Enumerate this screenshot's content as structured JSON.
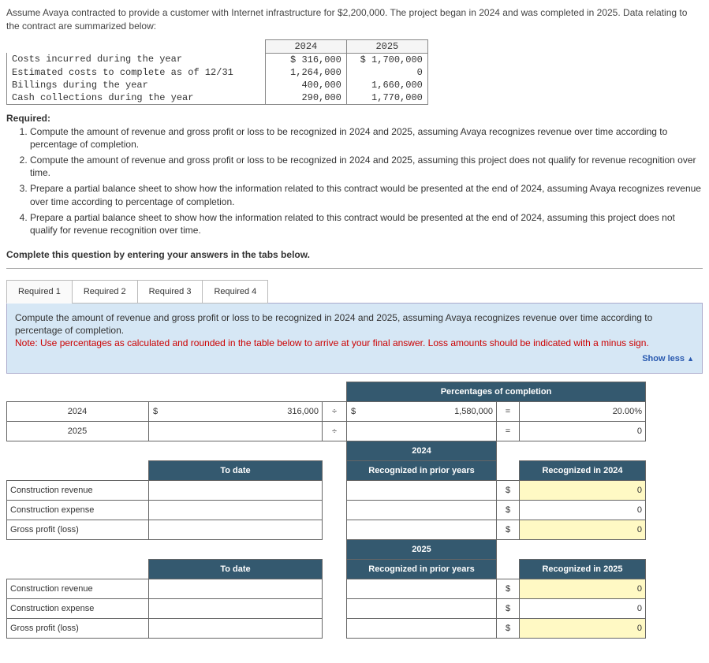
{
  "intro": "Assume Avaya contracted to provide a customer with Internet infrastructure for $2,200,000. The project began in 2024 and was completed in 2025. Data relating to the contract are summarized below:",
  "data_table": {
    "cols": [
      "2024",
      "2025"
    ],
    "rows": [
      {
        "label": "Costs incurred during the year",
        "v1": "$ 316,000",
        "v2": "$ 1,700,000"
      },
      {
        "label": "Estimated costs to complete as of 12/31",
        "v1": "1,264,000",
        "v2": "0"
      },
      {
        "label": "Billings during the year",
        "v1": "400,000",
        "v2": "1,660,000"
      },
      {
        "label": "Cash collections during the year",
        "v1": "290,000",
        "v2": "1,770,000"
      }
    ]
  },
  "required_heading": "Required:",
  "requirements": [
    "Compute the amount of revenue and gross profit or loss to be recognized in 2024 and 2025, assuming Avaya recognizes revenue over time according to percentage of completion.",
    "Compute the amount of revenue and gross profit or loss to be recognized in 2024 and 2025, assuming this project does not qualify for revenue recognition over time.",
    "Prepare a partial balance sheet to show how the information related to this contract would be presented at the end of 2024, assuming Avaya recognizes revenue over time according to percentage of completion.",
    "Prepare a partial balance sheet to show how the information related to this contract would be presented at the end of 2024, assuming this project does not qualify for revenue recognition over time."
  ],
  "complete_line": "Complete this question by entering your answers in the tabs below.",
  "tabs": [
    "Required 1",
    "Required 2",
    "Required 3",
    "Required 4"
  ],
  "active_tab": 0,
  "instr_main": "Compute the amount of revenue and gross profit or loss to be recognized in 2024 and 2025, assuming Avaya recognizes revenue over time according to percentage of completion.",
  "instr_note": "Note: Use percentages as calculated and rounded in the table below to arrive at your final answer. Loss amounts should be indicated with a minus sign.",
  "show_less": "Show less",
  "answer": {
    "pct_header": "Percentages of completion",
    "year_rows": [
      "2024",
      "2025"
    ],
    "pct_row1": {
      "cost": "316,000",
      "total": "1,580,000",
      "pct": "20.00%"
    },
    "pct_row2": {
      "pct": "0"
    },
    "section_2024": "2024",
    "section_2025": "2025",
    "to_date": "To date",
    "prior_2024": "Recognized in prior years",
    "prior_2025": "Recognized in prior years",
    "rec_2024": "Recognized in 2024",
    "rec_2025": "Recognized in 2025",
    "lines": [
      "Construction revenue",
      "Construction expense",
      "Gross profit (loss)"
    ],
    "zero": "0",
    "dollar": "$",
    "divide": "÷",
    "equals": "="
  }
}
